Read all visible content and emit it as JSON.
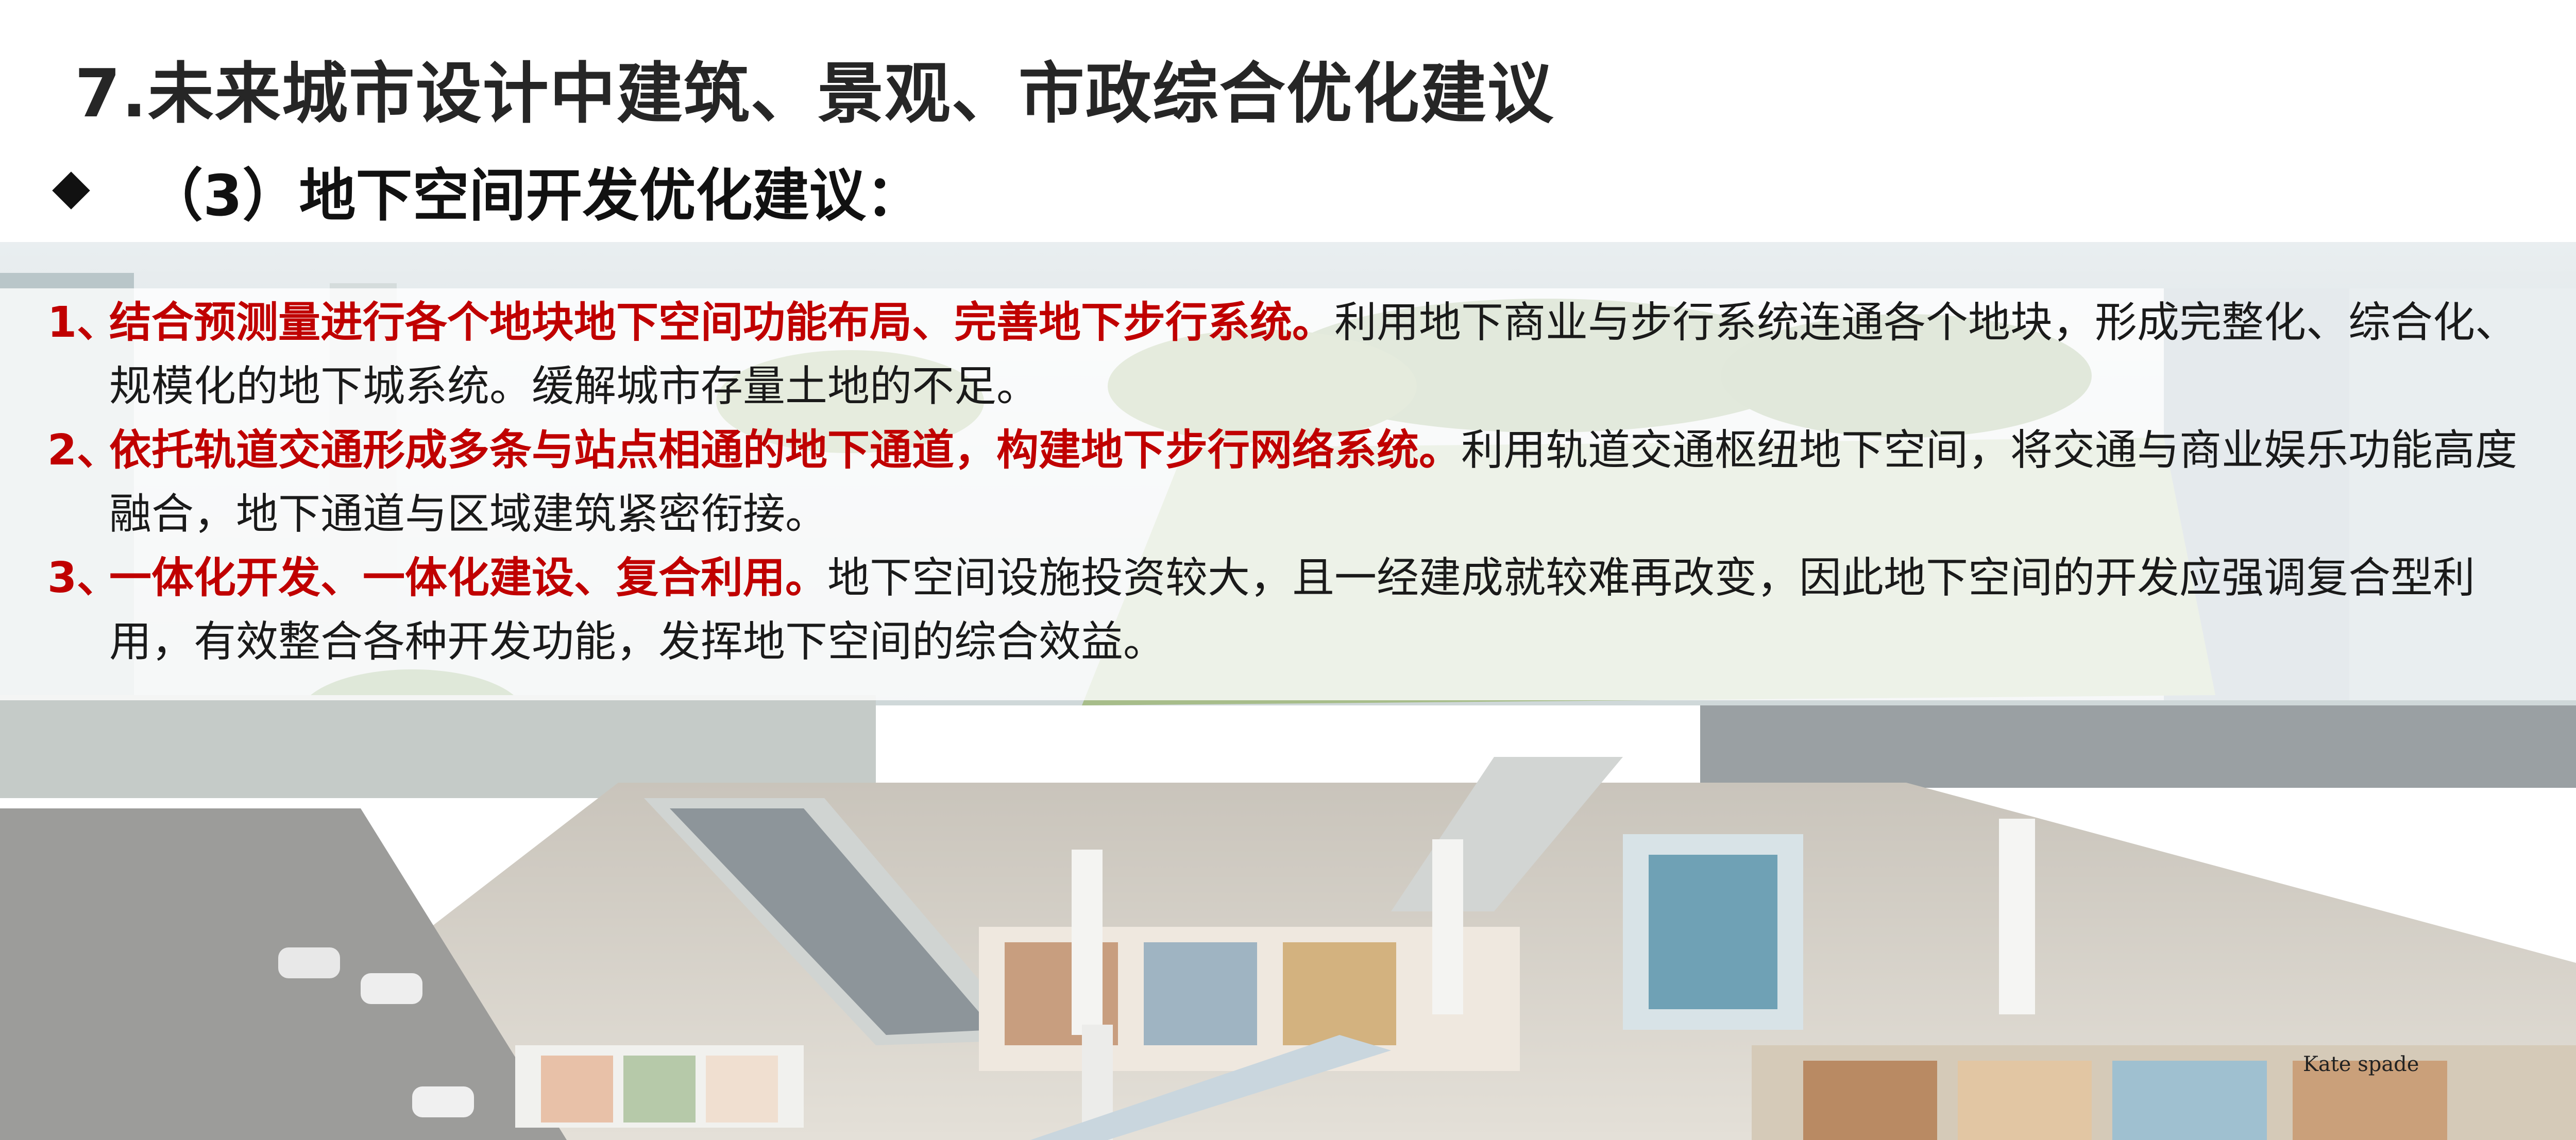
{
  "slide": {
    "title": "7.未来城市设计中建筑、景观、市政综合优化建议",
    "subtitle": "（3）地下空间开发优化建议：",
    "items": [
      {
        "num": "1、",
        "heading": "结合预测量进行各个地块地下空间功能布局、完善地下步行系统。",
        "body": "利用地下商业与步行系统连通各个地块，形成完整化、综合化、规模化的地下城系统。缓解城市存量土地的不足。"
      },
      {
        "num": "2、",
        "heading": "依托轨道交通形成多条与站点相通的地下通道，构建地下步行网络系统。",
        "body": "利用轨道交通枢纽地下空间，将交通与商业娱乐功能高度融合，地下通道与区域建筑紧密衔接。"
      },
      {
        "num": "3、",
        "heading": "一体化开发、一体化建设、复合利用。",
        "body": "地下空间设施投资较大，且一经建成就较难再改变，因此地下空间的开发应强调复合型利用，有效整合各种开发功能，发挥地下空间的综合效益。"
      }
    ]
  },
  "colors": {
    "accent_red": "#c00000",
    "text_dark": "#1a1a1a",
    "title_gray": "#262626"
  },
  "illustration": {
    "signage": "Kate spade"
  }
}
